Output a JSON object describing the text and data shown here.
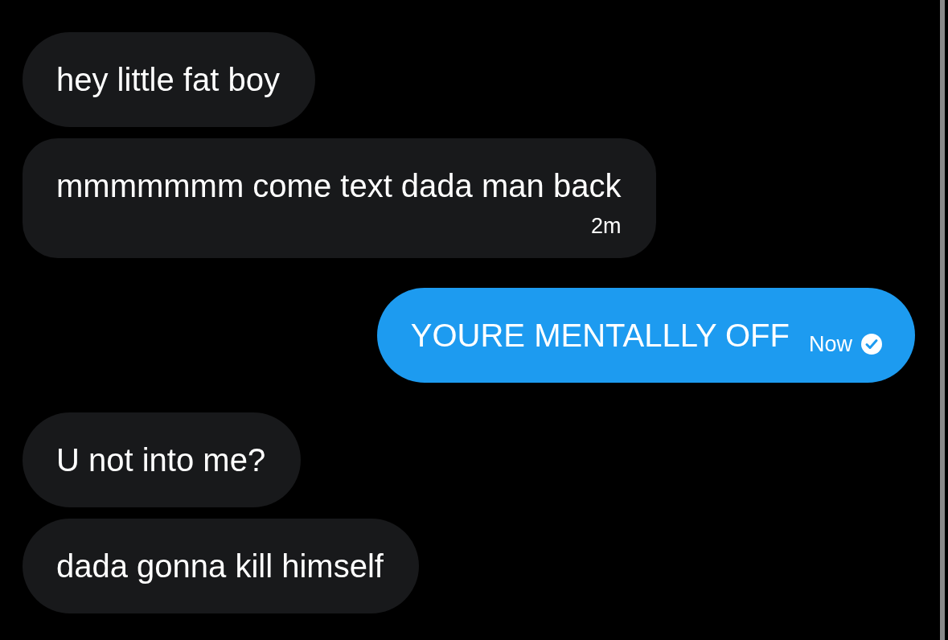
{
  "messages": [
    {
      "kind": "received",
      "text": "hey little fat boy"
    },
    {
      "kind": "received",
      "text": "mmmmmmm come text dada man back",
      "time": "2m"
    },
    {
      "kind": "sent",
      "text": "YOURE MENTALLLY OFF",
      "time": "Now",
      "read": true
    },
    {
      "kind": "received",
      "text": "U not into me?"
    },
    {
      "kind": "received",
      "text": "dada gonna kill himself"
    }
  ]
}
